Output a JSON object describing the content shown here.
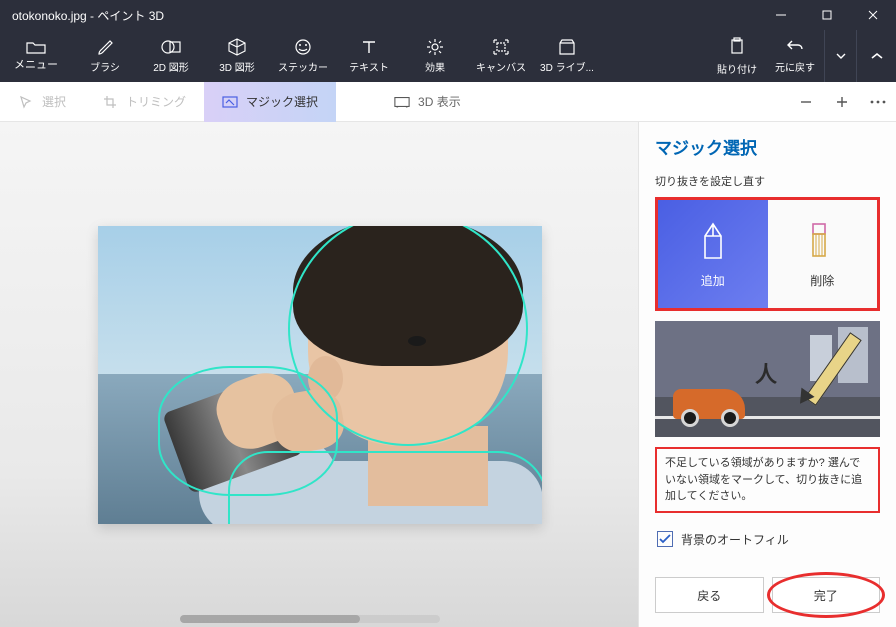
{
  "title": "otokonoko.jpg - ペイント 3D",
  "menu_label": "メニュー",
  "tools": {
    "brushes": "ブラシ",
    "shapes2d": "2D 図形",
    "shapes3d": "3D 図形",
    "stickers": "ステッカー",
    "text": "テキスト",
    "effects": "効果",
    "canvas": "キャンバス",
    "library3d": "3D ライブ...",
    "paste": "貼り付け",
    "undo": "元に戻す"
  },
  "subbar": {
    "select": "選択",
    "trim": "トリミング",
    "magic": "マジック選択",
    "view3d": "3D 表示"
  },
  "panel": {
    "title": "マジック選択",
    "section_label": "切り抜きを設定し直す",
    "add": "追加",
    "remove": "削除",
    "hint": "不足している領域がありますか? 選んでいない領域をマークして、切り抜きに追加してください。",
    "autofill": "背景のオートフィル",
    "back": "戻る",
    "done": "完了"
  }
}
